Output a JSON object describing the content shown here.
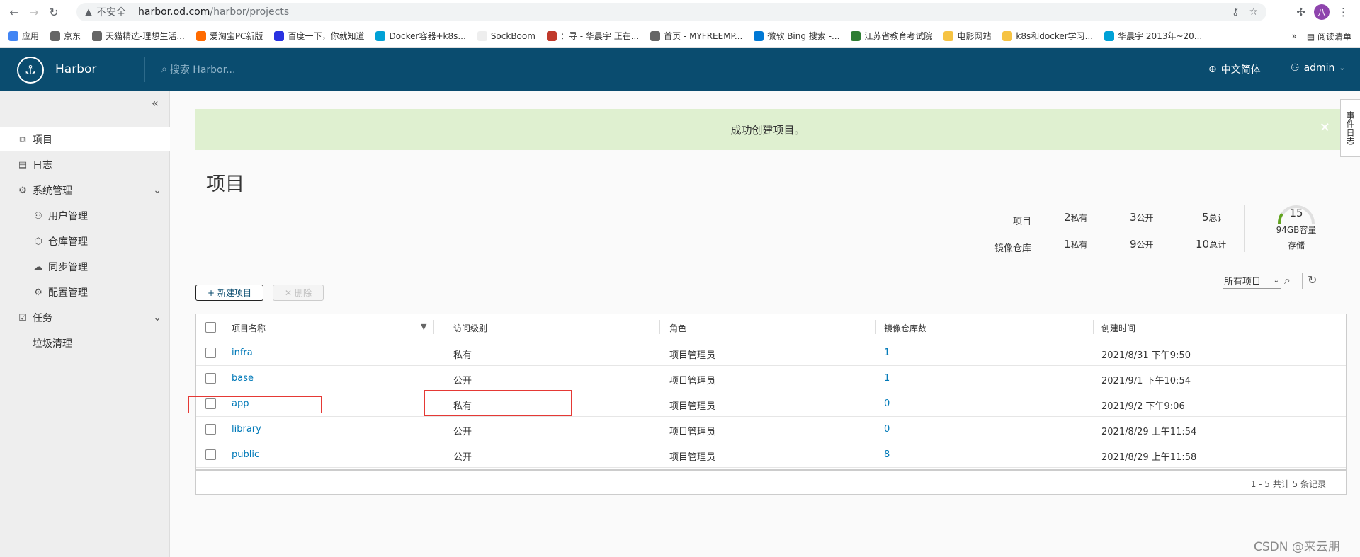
{
  "browser": {
    "insecure_label": "不安全",
    "url_host": "harbor.od.com",
    "url_path": "/harbor/projects",
    "avatar_letter": "八",
    "bookmarks": [
      {
        "label": "应用",
        "color": "#4285f4"
      },
      {
        "label": "京东",
        "color": "#666"
      },
      {
        "label": "天猫精选-理想生活...",
        "color": "#666"
      },
      {
        "label": "爱淘宝PC新版",
        "color": "#ff6a00"
      },
      {
        "label": "百度一下，你就知道",
        "color": "#2932e1"
      },
      {
        "label": "Docker容器+k8s...",
        "color": "#00a1d6"
      },
      {
        "label": "SockBoom",
        "color": "#eee"
      },
      {
        "label": "：寻 - 华晨宇 正在...",
        "color": "#c0392b"
      },
      {
        "label": "首页 - MYFREEMP...",
        "color": "#666"
      },
      {
        "label": "微软 Bing 搜索 -...",
        "color": "#0078d4"
      },
      {
        "label": "江苏省教育考试院",
        "color": "#2e7d32"
      },
      {
        "label": "电影网站",
        "color": "#f6c343"
      },
      {
        "label": "k8s和docker学习...",
        "color": "#f6c343"
      },
      {
        "label": "华晨宇 2013年~20...",
        "color": "#00a1d6"
      }
    ],
    "more": "»",
    "reading_list": "阅读清单"
  },
  "header": {
    "brand": "Harbor",
    "search_placeholder": "搜索 Harbor...",
    "language": "中文简体",
    "user": "admin"
  },
  "sidebar": {
    "items": [
      {
        "label": "项目",
        "icon": "project-icon"
      },
      {
        "label": "日志",
        "icon": "log-icon"
      },
      {
        "label": "系统管理",
        "icon": "admin-icon"
      },
      {
        "label": "用户管理",
        "icon": "users-icon"
      },
      {
        "label": "仓库管理",
        "icon": "registry-icon"
      },
      {
        "label": "同步管理",
        "icon": "replication-icon"
      },
      {
        "label": "配置管理",
        "icon": "config-icon"
      },
      {
        "label": "任务",
        "icon": "task-icon"
      },
      {
        "label": "垃圾清理",
        "icon": ""
      }
    ]
  },
  "alert": {
    "message": "成功创建项目。"
  },
  "side_tab": "事件日志",
  "main": {
    "title": "项目",
    "stats": {
      "projects_label": "项目",
      "repos_label": "镜像仓库",
      "private_suffix": "私有",
      "public_suffix": "公开",
      "total_suffix": "总计",
      "projects_private": "2",
      "projects_public": "3",
      "projects_total": "5",
      "repos_private": "1",
      "repos_public": "9",
      "repos_total": "10",
      "gauge_value": "15",
      "capacity": "94GB容量",
      "storage_label": "存储"
    },
    "new_project_label": "新建项目",
    "delete_label": "删除",
    "filter_value": "所有项目",
    "table": {
      "headers": [
        "项目名称",
        "访问级别",
        "角色",
        "镜像仓库数",
        "创建时间"
      ],
      "rows": [
        {
          "name": "infra",
          "access": "私有",
          "role": "项目管理员",
          "repos": "1",
          "created": "2021/8/31 下午9:50"
        },
        {
          "name": "base",
          "access": "公开",
          "role": "项目管理员",
          "repos": "1",
          "created": "2021/9/1 下午10:54"
        },
        {
          "name": "app",
          "access": "私有",
          "role": "项目管理员",
          "repos": "0",
          "created": "2021/9/2 下午9:06"
        },
        {
          "name": "library",
          "access": "公开",
          "role": "项目管理员",
          "repos": "0",
          "created": "2021/8/29 上午11:54"
        },
        {
          "name": "public",
          "access": "公开",
          "role": "项目管理员",
          "repos": "8",
          "created": "2021/8/29 上午11:58"
        }
      ],
      "footer": "1 - 5 共计 5 条记录"
    }
  },
  "watermark": "CSDN @来云朋"
}
